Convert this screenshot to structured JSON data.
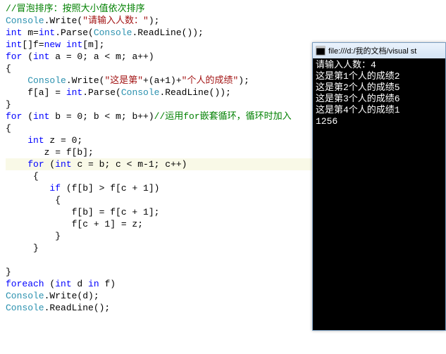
{
  "code": {
    "lines": [
      [
        {
          "cls": "cm",
          "t": "//冒泡排序：按照大小值依次排序"
        }
      ],
      [
        {
          "cls": "cls",
          "t": "Console"
        },
        {
          "cls": "txt",
          "t": ".Write("
        },
        {
          "cls": "str",
          "t": "\"请输入人数：\""
        },
        {
          "cls": "txt",
          "t": ");"
        }
      ],
      [
        {
          "cls": "kw",
          "t": "int"
        },
        {
          "cls": "txt",
          "t": " m="
        },
        {
          "cls": "kw",
          "t": "int"
        },
        {
          "cls": "txt",
          "t": ".Parse("
        },
        {
          "cls": "cls",
          "t": "Console"
        },
        {
          "cls": "txt",
          "t": ".ReadLine());"
        }
      ],
      [
        {
          "cls": "kw",
          "t": "int"
        },
        {
          "cls": "txt",
          "t": "[]f="
        },
        {
          "cls": "kw",
          "t": "new"
        },
        {
          "cls": "txt",
          "t": " "
        },
        {
          "cls": "kw",
          "t": "int"
        },
        {
          "cls": "txt",
          "t": "[m];"
        }
      ],
      [
        {
          "cls": "kw",
          "t": "for"
        },
        {
          "cls": "txt",
          "t": " ("
        },
        {
          "cls": "kw",
          "t": "int"
        },
        {
          "cls": "txt",
          "t": " a = 0; a < m; a++)"
        }
      ],
      [
        {
          "cls": "txt",
          "t": "{"
        }
      ],
      [
        {
          "cls": "txt",
          "t": "    "
        },
        {
          "cls": "cls",
          "t": "Console"
        },
        {
          "cls": "txt",
          "t": ".Write("
        },
        {
          "cls": "str",
          "t": "\"这是第\""
        },
        {
          "cls": "txt",
          "t": "+(a+1)+"
        },
        {
          "cls": "str",
          "t": "\"个人的成绩\""
        },
        {
          "cls": "txt",
          "t": ");"
        }
      ],
      [
        {
          "cls": "txt",
          "t": "    f[a] = "
        },
        {
          "cls": "kw",
          "t": "int"
        },
        {
          "cls": "txt",
          "t": ".Parse("
        },
        {
          "cls": "cls",
          "t": "Console"
        },
        {
          "cls": "txt",
          "t": ".ReadLine());"
        }
      ],
      [
        {
          "cls": "txt",
          "t": "}"
        }
      ],
      [
        {
          "cls": "kw",
          "t": "for"
        },
        {
          "cls": "txt",
          "t": " ("
        },
        {
          "cls": "kw",
          "t": "int"
        },
        {
          "cls": "txt",
          "t": " b = 0; b < m; b++)"
        },
        {
          "cls": "cm",
          "t": "//运用for嵌套循环，循环时加入"
        }
      ],
      [
        {
          "cls": "txt",
          "t": "{"
        }
      ],
      [
        {
          "cls": "txt",
          "t": "    "
        },
        {
          "cls": "kw",
          "t": "int"
        },
        {
          "cls": "txt",
          "t": " z = 0;"
        }
      ],
      [
        {
          "cls": "txt",
          "t": "       z = f[b];"
        }
      ],
      [
        {
          "cls": "txt",
          "t": "    "
        },
        {
          "cls": "kw",
          "t": "for"
        },
        {
          "cls": "txt",
          "t": " ("
        },
        {
          "cls": "kw",
          "t": "int"
        },
        {
          "cls": "txt",
          "t": " c = b; c < m-1; c++)"
        }
      ],
      [
        {
          "cls": "txt",
          "t": "     {"
        }
      ],
      [
        {
          "cls": "txt",
          "t": "        "
        },
        {
          "cls": "kw",
          "t": "if"
        },
        {
          "cls": "txt",
          "t": " (f[b] > f[c + 1])"
        }
      ],
      [
        {
          "cls": "txt",
          "t": "         {"
        }
      ],
      [
        {
          "cls": "txt",
          "t": "            f[b] = f[c + 1];"
        }
      ],
      [
        {
          "cls": "txt",
          "t": "            f[c + 1] = z;"
        }
      ],
      [
        {
          "cls": "txt",
          "t": "         }"
        }
      ],
      [
        {
          "cls": "txt",
          "t": "     }"
        }
      ],
      [
        {
          "cls": "txt",
          "t": "    "
        }
      ],
      [
        {
          "cls": "txt",
          "t": "}"
        }
      ],
      [
        {
          "cls": "kw",
          "t": "foreach"
        },
        {
          "cls": "txt",
          "t": " ("
        },
        {
          "cls": "kw",
          "t": "int"
        },
        {
          "cls": "txt",
          "t": " d "
        },
        {
          "cls": "kw",
          "t": "in"
        },
        {
          "cls": "txt",
          "t": " f)"
        }
      ],
      [
        {
          "cls": "cls",
          "t": "Console"
        },
        {
          "cls": "txt",
          "t": ".Write(d);"
        }
      ],
      [
        {
          "cls": "cls",
          "t": "Console"
        },
        {
          "cls": "txt",
          "t": ".ReadLine();"
        }
      ]
    ],
    "highlight_index": 13
  },
  "console": {
    "title": "file:///d:/我的文档/visual st",
    "output": "请输入人数：4\n这是第1个人的成绩2\n这是第2个人的成绩5\n这是第3个人的成绩6\n这是第4个人的成绩1\n1256"
  }
}
